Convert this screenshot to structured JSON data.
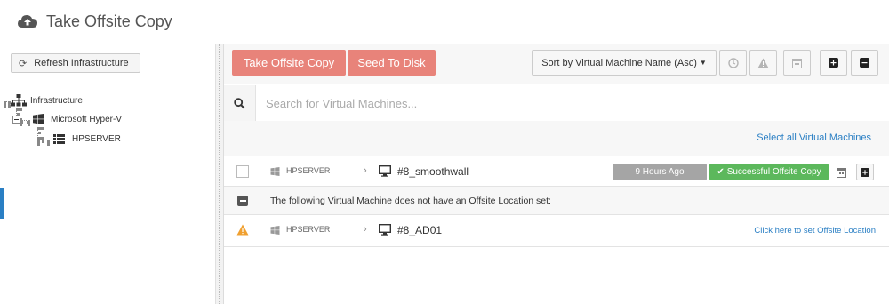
{
  "header": {
    "title": "Take Offsite Copy",
    "icon": "cloud-upload-icon"
  },
  "sidebar": {
    "refresh_label": "Refresh Infrastructure",
    "tree": {
      "root_label": "Infrastructure",
      "hypervisor_label": "Microsoft Hyper-V",
      "host_label": "HPSERVER"
    }
  },
  "toolbar": {
    "take_offsite_copy_label": "Take Offsite Copy",
    "seed_to_disk_label": "Seed To Disk",
    "sort_label": "Sort by Virtual Machine Name (Asc)",
    "icons": [
      "clock-icon",
      "warning-icon",
      "calendar-icon",
      "plus-icon",
      "minus-icon"
    ]
  },
  "search": {
    "placeholder": "Search for Virtual Machines..."
  },
  "select_all_label": "Select all Virtual Machines",
  "vms": [
    {
      "host": "HPSERVER",
      "name": "#8_smoothwall",
      "last_copy": "9 Hours Ago",
      "status": "Successful Offsite Copy"
    },
    {
      "host": "HPSERVER",
      "name": "#8_AD01",
      "action_link": "Click here to set Offsite Location"
    }
  ],
  "warning_group_text": "The following Virtual Machine does not have an Offsite Location set:",
  "colors": {
    "accent_red": "#e8837a",
    "success_green": "#5cb85c",
    "link_blue": "#2a7fc4",
    "warning_orange": "#f0a030"
  }
}
